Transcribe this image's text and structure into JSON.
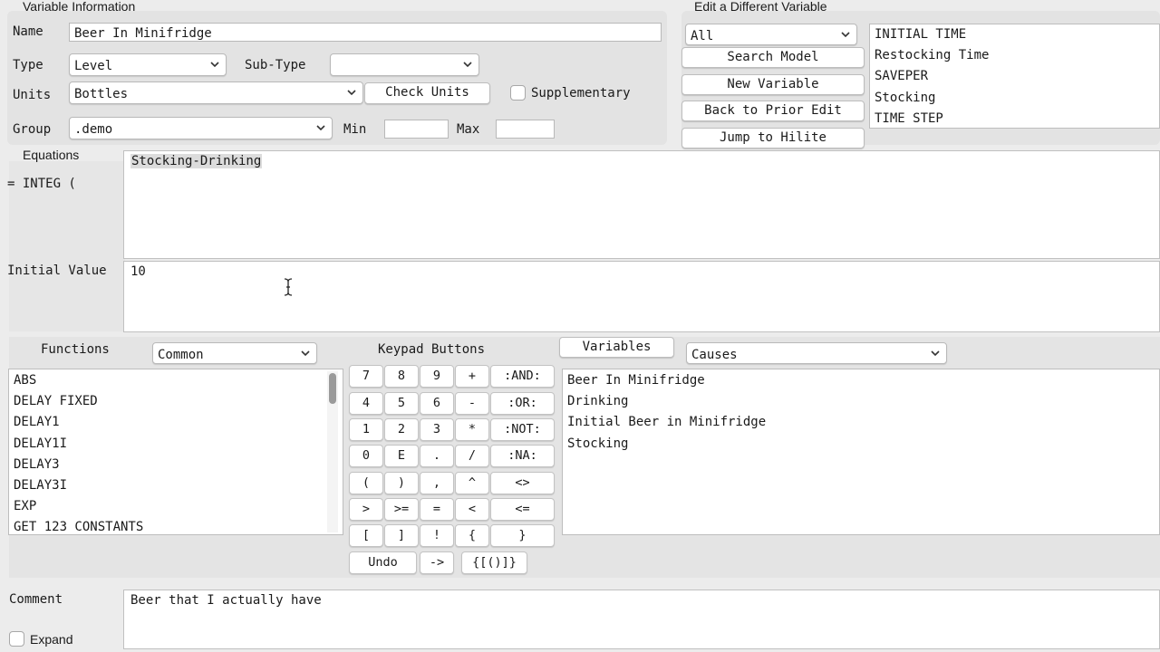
{
  "variable_info": {
    "section_title": "Variable Information",
    "name_label": "Name",
    "name_value": "Beer In Minifridge",
    "type_label": "Type",
    "type_value": "Level",
    "subtype_label": "Sub-Type",
    "subtype_value": "",
    "units_label": "Units",
    "units_value": "Bottles",
    "check_units_label": "Check Units",
    "supplementary_label": "Supplementary",
    "supplementary_checked": false,
    "group_label": "Group",
    "group_value": ".demo",
    "min_label": "Min",
    "min_value": "",
    "max_label": "Max",
    "max_value": ""
  },
  "edit_different": {
    "section_title": "Edit a Different Variable",
    "filter_value": "All",
    "buttons": [
      "Search Model",
      "New Variable",
      "Back to Prior Edit",
      "Jump to Hilite"
    ],
    "variables": [
      "INITIAL TIME",
      "Restocking Time",
      "SAVEPER",
      "Stocking",
      "TIME STEP"
    ]
  },
  "equations": {
    "section_title": "Equations",
    "prefix": "= INTEG (",
    "value": "Stocking-Drinking"
  },
  "initial_value": {
    "label": "Initial Value",
    "value": "10"
  },
  "functions": {
    "title": "Functions",
    "category": "Common",
    "items": [
      "ABS",
      "DELAY FIXED",
      "DELAY1",
      "DELAY1I",
      "DELAY3",
      "DELAY3I",
      "EXP",
      "GET 123 CONSTANTS"
    ]
  },
  "keypad": {
    "title": "Keypad Buttons",
    "rows": [
      [
        "7",
        "8",
        "9",
        "+",
        ":AND:"
      ],
      [
        "4",
        "5",
        "6",
        "-",
        ":OR:"
      ],
      [
        "1",
        "2",
        "3",
        "*",
        ":NOT:"
      ],
      [
        "0",
        "E",
        ".",
        "/",
        ":NA:"
      ],
      [
        "(",
        ")",
        ",",
        "^",
        "<>"
      ],
      [
        ">",
        ">=",
        "=",
        "<",
        "<="
      ],
      [
        "[",
        "]",
        "!",
        "{",
        "}"
      ]
    ],
    "last_row": [
      "Undo",
      "->",
      "{[()]}"
    ]
  },
  "variables_panel": {
    "button_label": "Variables",
    "filter_value": "Causes",
    "items": [
      "Beer In Minifridge",
      "Drinking",
      "Initial Beer in Minifridge",
      "Stocking"
    ]
  },
  "comment": {
    "label": "Comment",
    "value": "Beer that I actually have",
    "expand_label": "Expand",
    "expand_checked": false
  }
}
